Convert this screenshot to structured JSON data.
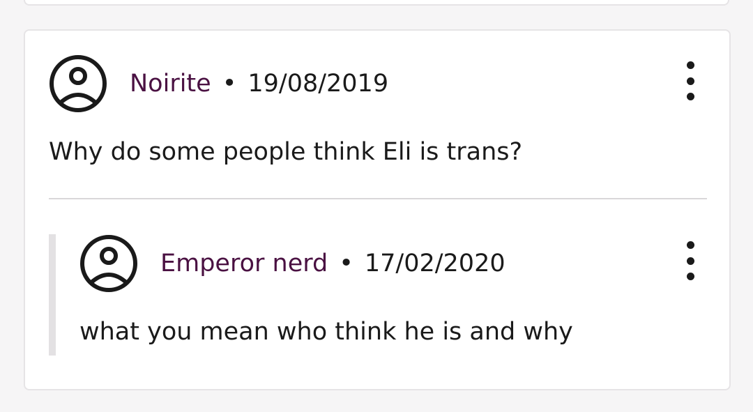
{
  "comments": [
    {
      "username": "Noirite",
      "separator": "•",
      "date": "19/08/2019",
      "text": "Why do some people think Eli is trans?"
    },
    {
      "username": "Emperor nerd",
      "separator": "•",
      "date": "17/02/2020",
      "text": "what you mean who think he is and why"
    }
  ],
  "icons": {
    "avatar": "user-avatar-icon",
    "menu": "kebab-menu-icon"
  },
  "colors": {
    "username": "#4a1142",
    "text": "#1a1a1a",
    "card_border": "#e6e4e6",
    "page_background": "#f6f5f6",
    "reply_bar": "#e3e1e3"
  }
}
